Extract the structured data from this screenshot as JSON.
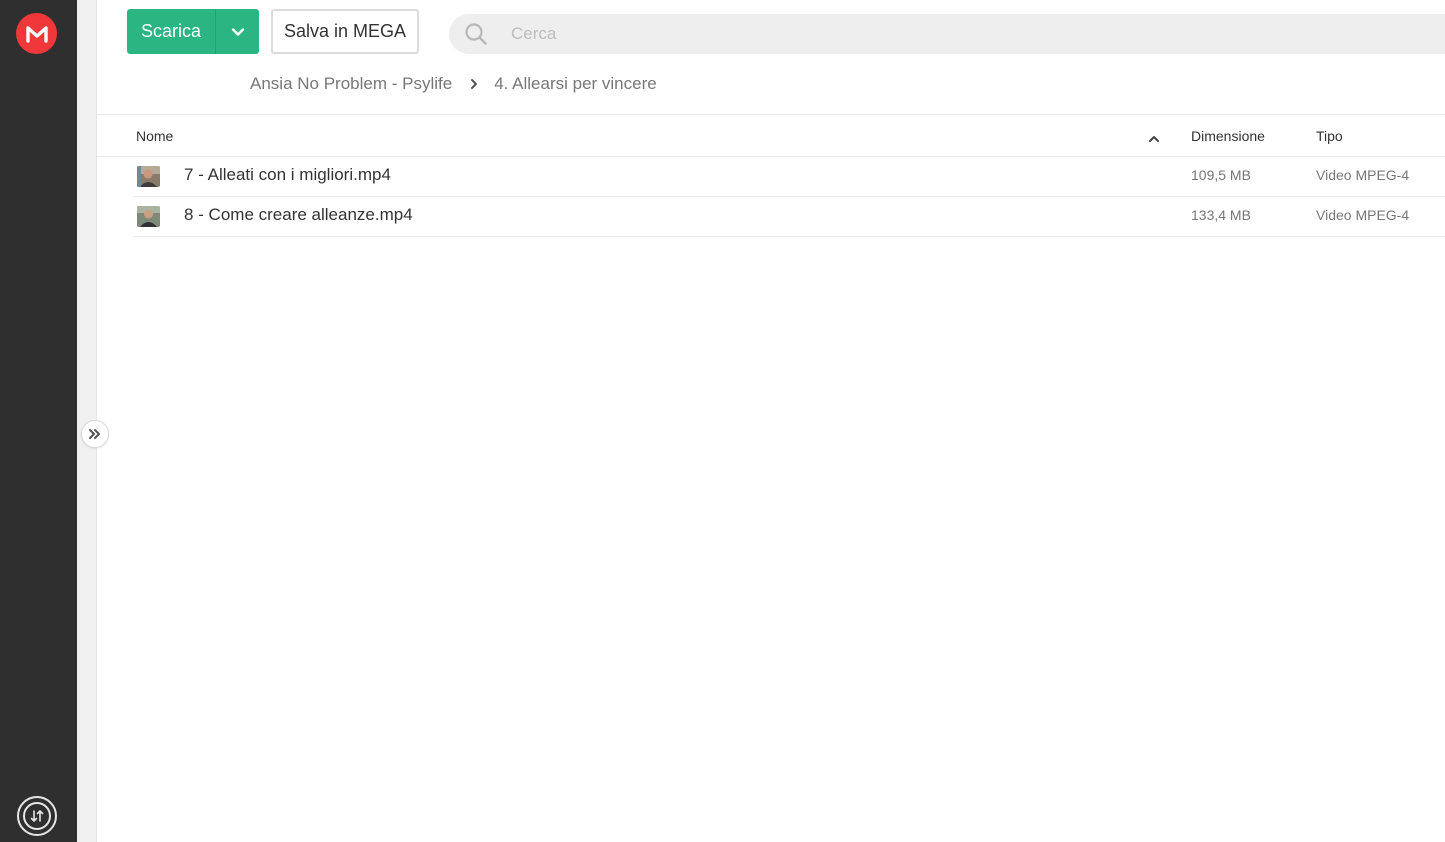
{
  "sidebar": {
    "logo_letter": "M",
    "logo_color": "#f0373a",
    "logo_icon": "mega-logo-icon",
    "transfer_icon": "transfer-icon"
  },
  "toolbar": {
    "download_label": "Scarica",
    "download_color": "#2bb583",
    "save_label": "Salva in MEGA"
  },
  "search": {
    "placeholder": "Cerca",
    "value": ""
  },
  "breadcrumb": [
    {
      "label": "Ansia No Problem - Psylife"
    },
    {
      "label": "4. Allearsi per vincere"
    }
  ],
  "table": {
    "headers": {
      "name": "Nome",
      "size": "Dimensione",
      "type": "Tipo"
    },
    "sort": "ascending",
    "rows": [
      {
        "name": "7 - Alleati con i migliori.mp4",
        "size": "109,5 MB",
        "type": "Video MPEG-4"
      },
      {
        "name": "8 - Come creare alleanze.mp4",
        "size": "133,4 MB",
        "type": "Video MPEG-4"
      }
    ]
  }
}
